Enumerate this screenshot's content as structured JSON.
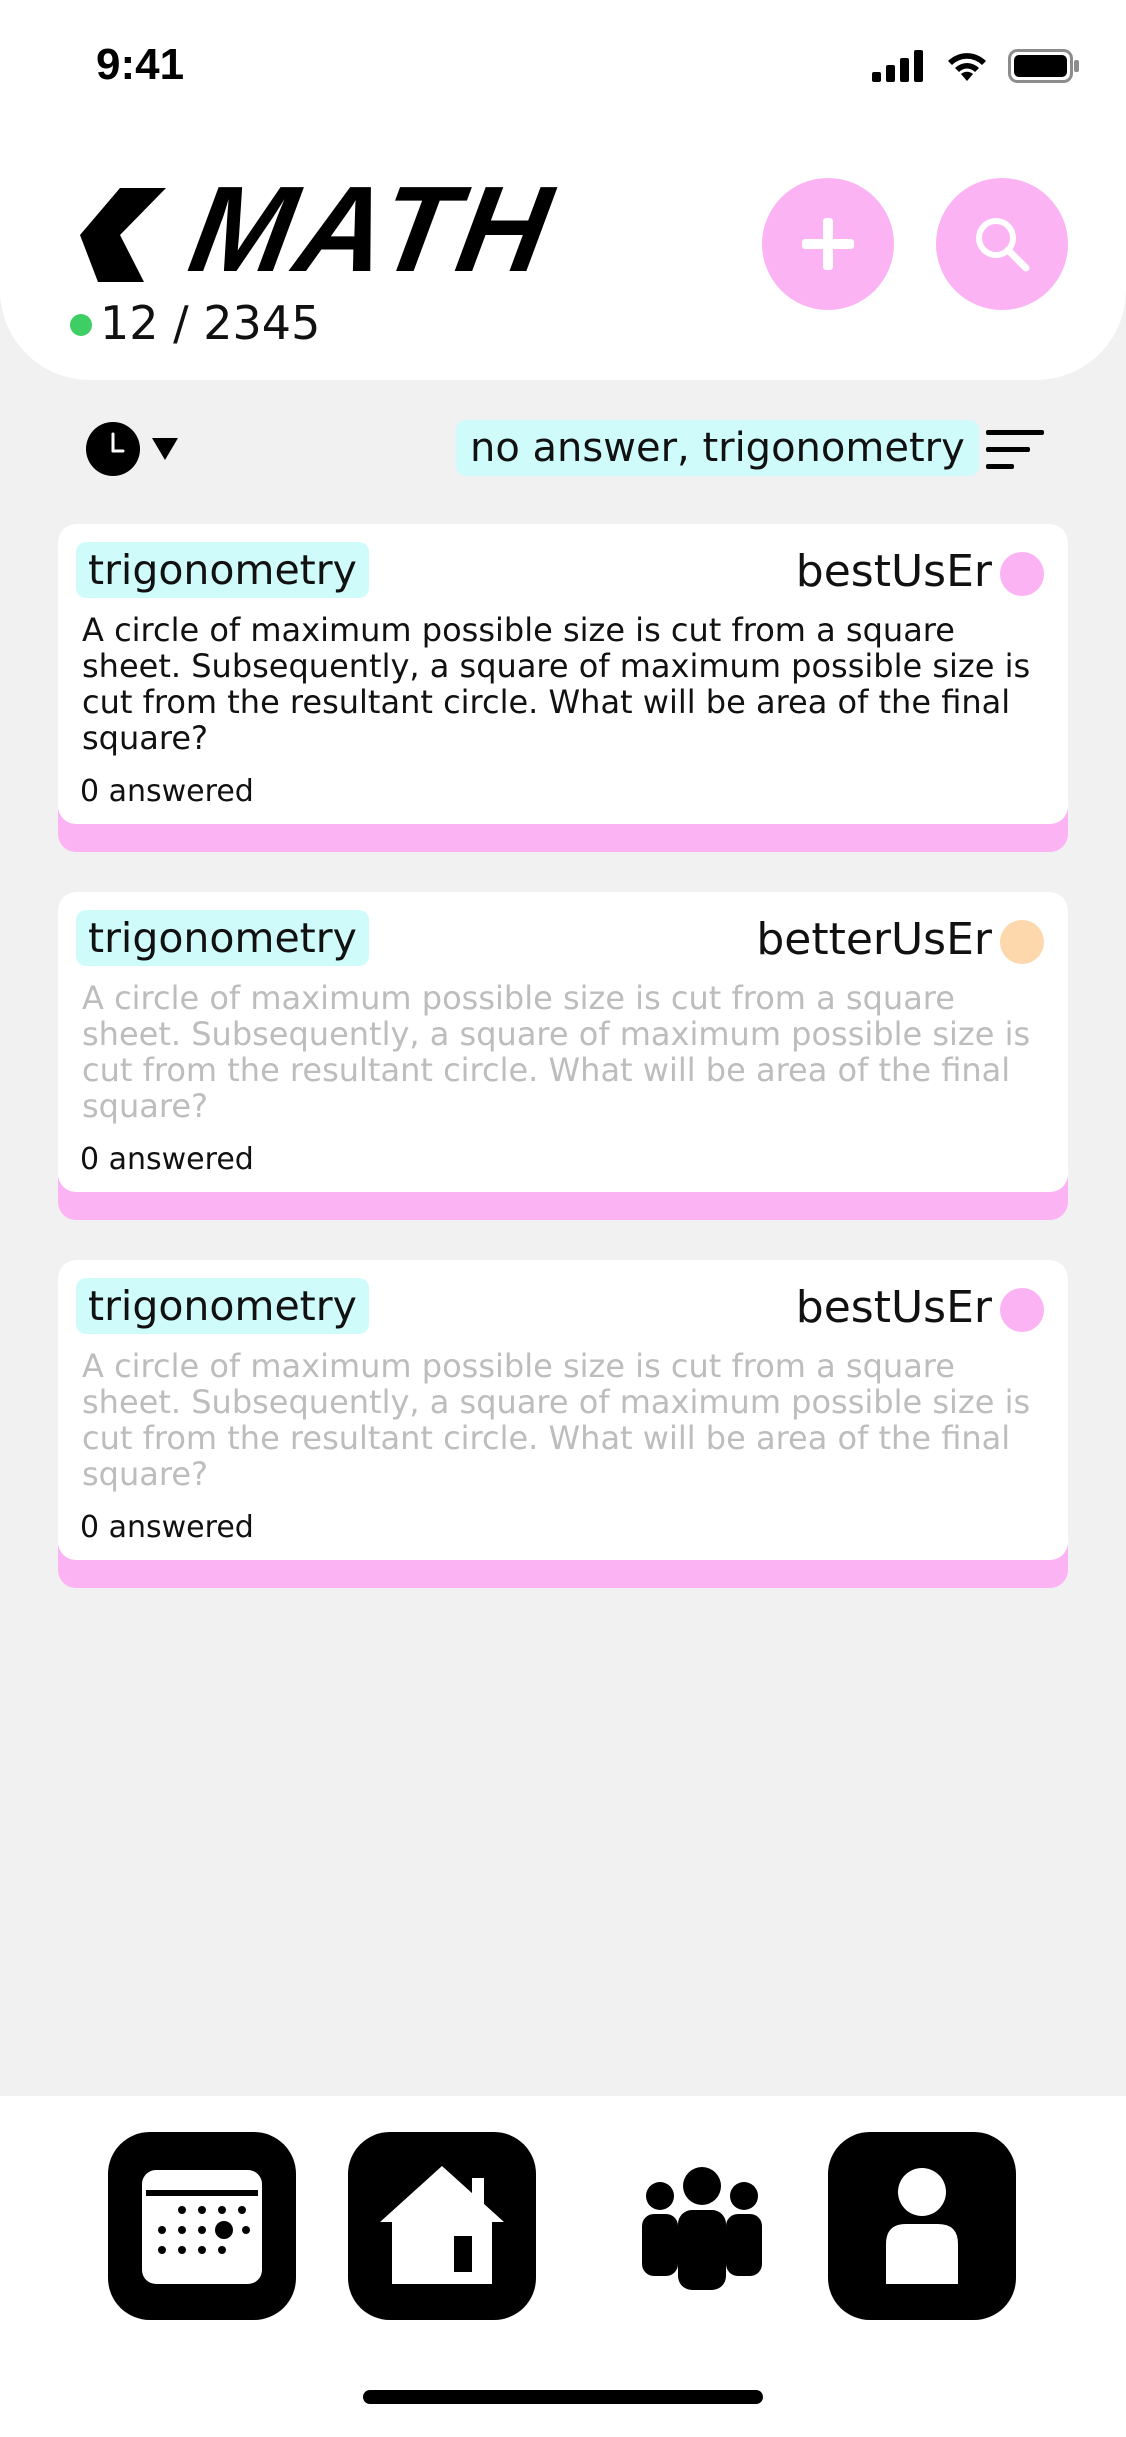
{
  "status_bar": {
    "time": "9:41",
    "icons": [
      "signal-icon",
      "wifi-icon",
      "battery-icon"
    ]
  },
  "header": {
    "title": "MATH",
    "counter": "12 / 2345",
    "back_icon": "chevron-left-icon",
    "add_icon": "plus-icon",
    "search_icon": "search-icon",
    "accent_color": "#fcb3f4"
  },
  "filter_bar": {
    "sort_icon": "clock-icon",
    "filter_text": "no answer, trigonometry",
    "filter_icon": "filter-lines-icon"
  },
  "cards": [
    {
      "topic": "trigonometry",
      "author": "bestUsEr",
      "author_color": "#fcb3f4",
      "question": " A circle of maximum possible size is cut from a square sheet. Subsequently, a square of maximum possible size is cut from the resultant circle. What will be area of the final square?",
      "answered": "0 answered"
    },
    {
      "topic": "trigonometry",
      "author": "betterUsEr",
      "author_color": "#fcd8ac",
      "question": " A circle of maximum possible size is cut from a square sheet. Subsequently, a square of maximum possible size is cut from the resultant circle. What will be area of the final square?",
      "answered": "0 answered"
    },
    {
      "topic": "trigonometry",
      "author": "bestUsEr",
      "author_color": "#fcb3f4",
      "question": " A circle of maximum possible size is cut from a square sheet. Subsequently, a square of maximum possible size is cut from the resultant circle. What will be area of the final square?",
      "answered": "0 answered"
    }
  ],
  "bottom_nav": [
    {
      "icon": "calendar-icon"
    },
    {
      "icon": "home-icon"
    },
    {
      "icon": "community-icon"
    },
    {
      "icon": "profile-icon"
    }
  ]
}
